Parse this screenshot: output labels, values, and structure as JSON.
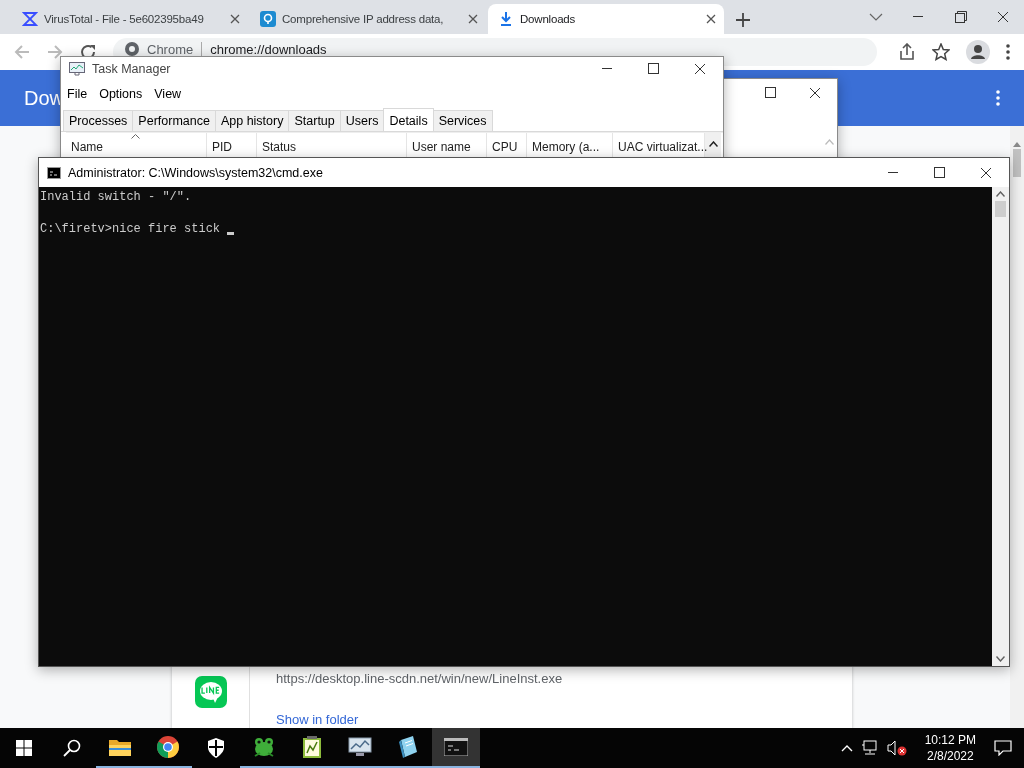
{
  "browser": {
    "tabs": [
      {
        "title": "VirusTotal - File - 5e602395ba49",
        "kind": "virustotal",
        "selected": false
      },
      {
        "title": "Comprehensive IP address data,",
        "kind": "location",
        "selected": false
      },
      {
        "title": "Downloads",
        "kind": "download",
        "selected": true
      }
    ],
    "omnibox": {
      "label": "Chrome",
      "url": "chrome://downloads"
    },
    "page_title": "Dow",
    "download": {
      "url": "https://desktop.line-scdn.net/win/new/LineInst.exe",
      "link": "Show in folder"
    }
  },
  "task_manager": {
    "title": "Task Manager",
    "menu": [
      "File",
      "Options",
      "View"
    ],
    "tabs": [
      {
        "label": "Processes",
        "selected": false
      },
      {
        "label": "Performance",
        "selected": false
      },
      {
        "label": "App history",
        "selected": false
      },
      {
        "label": "Startup",
        "selected": false
      },
      {
        "label": "Users",
        "selected": false
      },
      {
        "label": "Details",
        "selected": true
      },
      {
        "label": "Services",
        "selected": false
      }
    ],
    "columns": [
      {
        "label": "Name",
        "sorted": true
      },
      {
        "label": "PID",
        "sorted": false
      },
      {
        "label": "Status",
        "sorted": false
      },
      {
        "label": "User name",
        "sorted": false
      },
      {
        "label": "CPU",
        "sorted": false
      },
      {
        "label": "Memory (a...",
        "sorted": false
      },
      {
        "label": "UAC virtualizat...",
        "sorted": false
      }
    ]
  },
  "cmd": {
    "title": "Administrator: C:\\Windows\\system32\\cmd.exe",
    "lines": [
      "Invalid switch - \"/\".",
      "C:\\firetv>nice fire stick "
    ],
    "cursor_visible": true
  },
  "taskbar": {
    "apps": [
      {
        "kind": "start",
        "running": false,
        "selected": false
      },
      {
        "kind": "search",
        "running": false,
        "selected": false
      },
      {
        "kind": "explorer",
        "running": true,
        "selected": false
      },
      {
        "kind": "chrome",
        "running": true,
        "selected": false
      },
      {
        "kind": "shield",
        "running": false,
        "selected": false
      },
      {
        "kind": "frog",
        "running": true,
        "selected": false
      },
      {
        "kind": "notepad",
        "running": true,
        "selected": false
      },
      {
        "kind": "monitor",
        "running": true,
        "selected": false
      },
      {
        "kind": "book",
        "running": true,
        "selected": false
      },
      {
        "kind": "terminal",
        "running": true,
        "selected": true
      }
    ],
    "clock": {
      "time": "10:12 PM",
      "date": "2/8/2022"
    }
  }
}
